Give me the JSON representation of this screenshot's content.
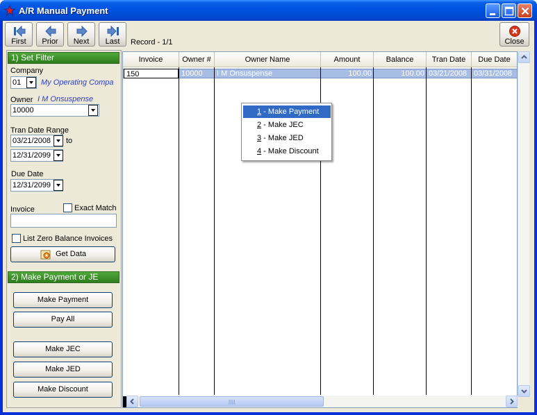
{
  "window": {
    "title": "A/R Manual Payment"
  },
  "toolbar": {
    "first_label": "First",
    "prior_label": "Prior",
    "next_label": "Next",
    "last_label": "Last",
    "record_text": "Record - 1/1",
    "close_label": "Close"
  },
  "filter": {
    "header": "1) Set Filter",
    "company_label": "Company",
    "company_value": "01",
    "company_name": "My Operating Compa",
    "owner_label": "Owner",
    "owner_name": "I M Onsuspense",
    "owner_value": "10000",
    "tran_date_label": "Tran Date Range",
    "tran_date_from": "03/21/2008",
    "tran_date_to_word": "to",
    "tran_date_to": "12/31/2099",
    "due_date_label": "Due Date",
    "due_date_value": "12/31/2099",
    "invoice_label": "Invoice",
    "invoice_value": "",
    "exact_match_label": "Exact Match",
    "exact_match_checked": false,
    "list_zero_label": "List Zero Balance Invoices",
    "list_zero_checked": false,
    "get_data_label": "Get Data"
  },
  "actions": {
    "header": "2) Make Payment or JE",
    "make_payment": "Make Payment",
    "pay_all": "Pay All",
    "make_jec": "Make JEC",
    "make_jed": "Make JED",
    "make_discount": "Make Discount"
  },
  "grid": {
    "columns": [
      "Invoice",
      "Owner #",
      "Owner Name",
      "Amount",
      "Balance",
      "Tran Date",
      "Due Date"
    ],
    "rows": [
      {
        "invoice": "150",
        "owner_num": "10000",
        "owner_name": "I M Onsuspense",
        "amount": "100.00",
        "balance": "100.00",
        "tran_date": "03/21/2008",
        "due_date": "03/31/2008"
      }
    ]
  },
  "context_menu": {
    "items": [
      {
        "key": "1",
        "label": " - Make Payment",
        "selected": true
      },
      {
        "key": "2",
        "label": " - Make JEC",
        "selected": false
      },
      {
        "key": "3",
        "label": " - Make JED",
        "selected": false
      },
      {
        "key": "4",
        "label": " - Make Discount",
        "selected": false
      }
    ]
  },
  "colors": {
    "titlebar": "#0054e3",
    "section_header": "#3a8f2a",
    "selection_row": "#a7bde3",
    "menu_highlight": "#316ac5",
    "link_text": "#2b3dc8"
  }
}
